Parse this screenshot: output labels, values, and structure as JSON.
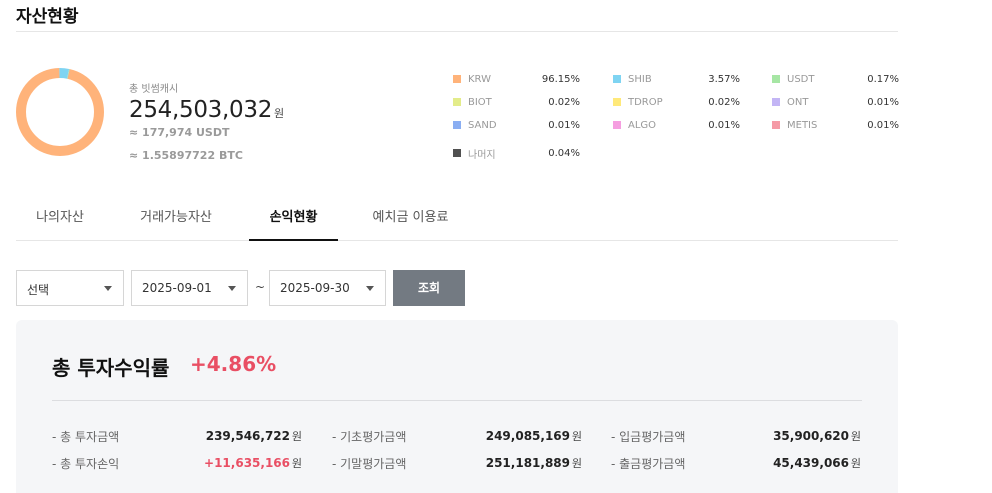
{
  "page": {
    "title": "자산현황"
  },
  "summary_top": {
    "label": "총 빗썸캐시",
    "amount": "254,503,032",
    "currency": "원",
    "usdt": "≈ 177,974 USDT",
    "btc": "≈ 1.55897722 BTC"
  },
  "allocation": [
    {
      "name": "KRW",
      "percent": "96.15%",
      "color": "#ffb37a",
      "share": 96.15
    },
    {
      "name": "SHIB",
      "percent": "3.57%",
      "color": "#7fd4f2",
      "share": 3.57
    },
    {
      "name": "USDT",
      "percent": "0.17%",
      "color": "#a6e6a4",
      "share": 0.17
    },
    {
      "name": "BIOT",
      "percent": "0.02%",
      "color": "#e3ec8a",
      "share": 0.02
    },
    {
      "name": "TDROP",
      "percent": "0.02%",
      "color": "#ffe97a",
      "share": 0.02
    },
    {
      "name": "ONT",
      "percent": "0.01%",
      "color": "#c3b5f5",
      "share": 0.01
    },
    {
      "name": "SAND",
      "percent": "0.01%",
      "color": "#8aaef2",
      "share": 0.01
    },
    {
      "name": "ALGO",
      "percent": "0.01%",
      "color": "#f59ee0",
      "share": 0.01
    },
    {
      "name": "METIS",
      "percent": "0.01%",
      "color": "#f59aa6",
      "share": 0.01
    },
    {
      "name": "나머지",
      "percent": "0.04%",
      "color": "#505050",
      "share": 0.04
    }
  ],
  "tabs": [
    {
      "label": "나의자산"
    },
    {
      "label": "거래가능자산"
    },
    {
      "label": "손익현황"
    },
    {
      "label": "예치금 이용료"
    }
  ],
  "active_tab": "손익현황",
  "filter": {
    "type_select": "선택",
    "start_date": "2025-09-01",
    "separator": "~",
    "end_date": "2025-09-30",
    "search_label": "조회"
  },
  "profit": {
    "title": "총 투자수익률",
    "rate": "+4.86%",
    "stats": [
      {
        "label": "- 총 투자금액",
        "value": "239,546,722",
        "unit": "원",
        "highlight": false
      },
      {
        "label": "- 기초평가금액",
        "value": "249,085,169",
        "unit": "원",
        "highlight": false
      },
      {
        "label": "- 입금평가금액",
        "value": "35,900,620",
        "unit": "원",
        "highlight": false
      },
      {
        "label": "- 총 투자손익",
        "value": "+11,635,166",
        "unit": "원",
        "highlight": true
      },
      {
        "label": "- 기말평가금액",
        "value": "251,181,889",
        "unit": "원",
        "highlight": false
      },
      {
        "label": "- 출금평가금액",
        "value": "45,439,066",
        "unit": "원",
        "highlight": false
      }
    ]
  }
}
